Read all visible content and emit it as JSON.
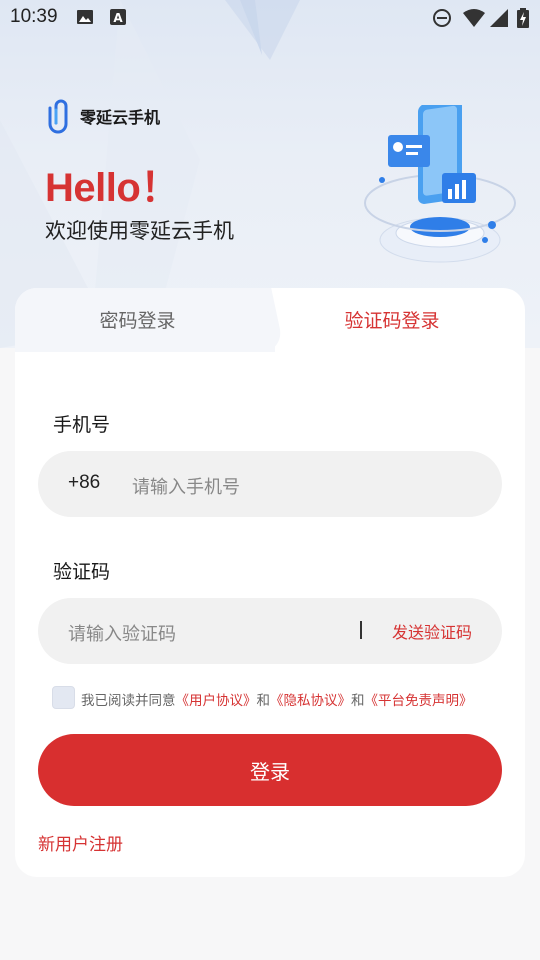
{
  "status_bar": {
    "time": "10:39",
    "icons": [
      "image-icon",
      "a-text-icon",
      "do-not-disturb-icon",
      "wifi-icon",
      "signal-icon",
      "battery-charging-icon"
    ]
  },
  "brand": {
    "name": "零延云手机",
    "logo_icon": "paperclip-logo-icon"
  },
  "hero": {
    "hello": "Hello！",
    "welcome": "欢迎使用零延云手机"
  },
  "tabs": [
    {
      "label": "密码登录",
      "active": false
    },
    {
      "label": "验证码登录",
      "active": true
    }
  ],
  "form": {
    "phone_label": "手机号",
    "phone_prefix": "+86",
    "phone_placeholder": "请输入手机号",
    "code_label": "验证码",
    "code_placeholder": "请输入验证码",
    "send_code": "发送验证码"
  },
  "agreement": {
    "checked": false,
    "prefix": "我已阅读并同意",
    "user_agreement": "《用户协议》",
    "and1": "和",
    "privacy": "《隐私协议》",
    "and2": "和",
    "disclaimer": "《平台免责声明》"
  },
  "login_button": "登录",
  "register_link": "新用户注册",
  "colors": {
    "accent": "#d63333",
    "button": "#d82f2f",
    "field_bg": "#f1f1f1",
    "logo_blue": "#2f6fe0"
  }
}
